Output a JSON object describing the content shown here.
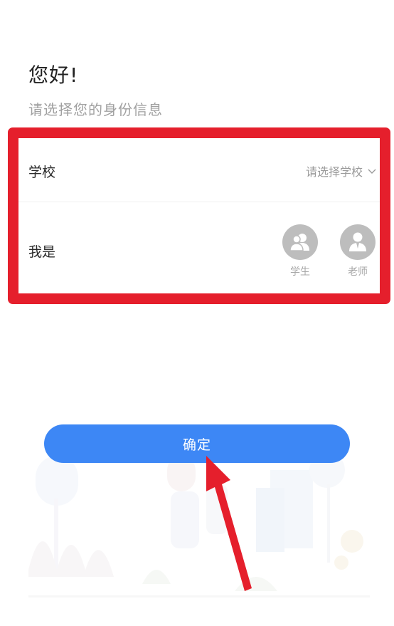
{
  "header": {
    "greeting": "您好!",
    "subtitle": "请选择您的身份信息"
  },
  "form": {
    "school": {
      "label": "学校",
      "placeholder": "请选择学校",
      "icon": "chevron-down-icon"
    },
    "role": {
      "label": "我是",
      "options": [
        {
          "label": "学生",
          "icon": "student-icon"
        },
        {
          "label": "老师",
          "icon": "teacher-icon"
        }
      ]
    }
  },
  "actions": {
    "confirm_label": "确定"
  },
  "colors": {
    "primary_button": "#3d87f5",
    "highlight_frame": "#e51f2c",
    "annotation_arrow": "#e51f2c",
    "avatar_bg": "#bdbdbd"
  }
}
